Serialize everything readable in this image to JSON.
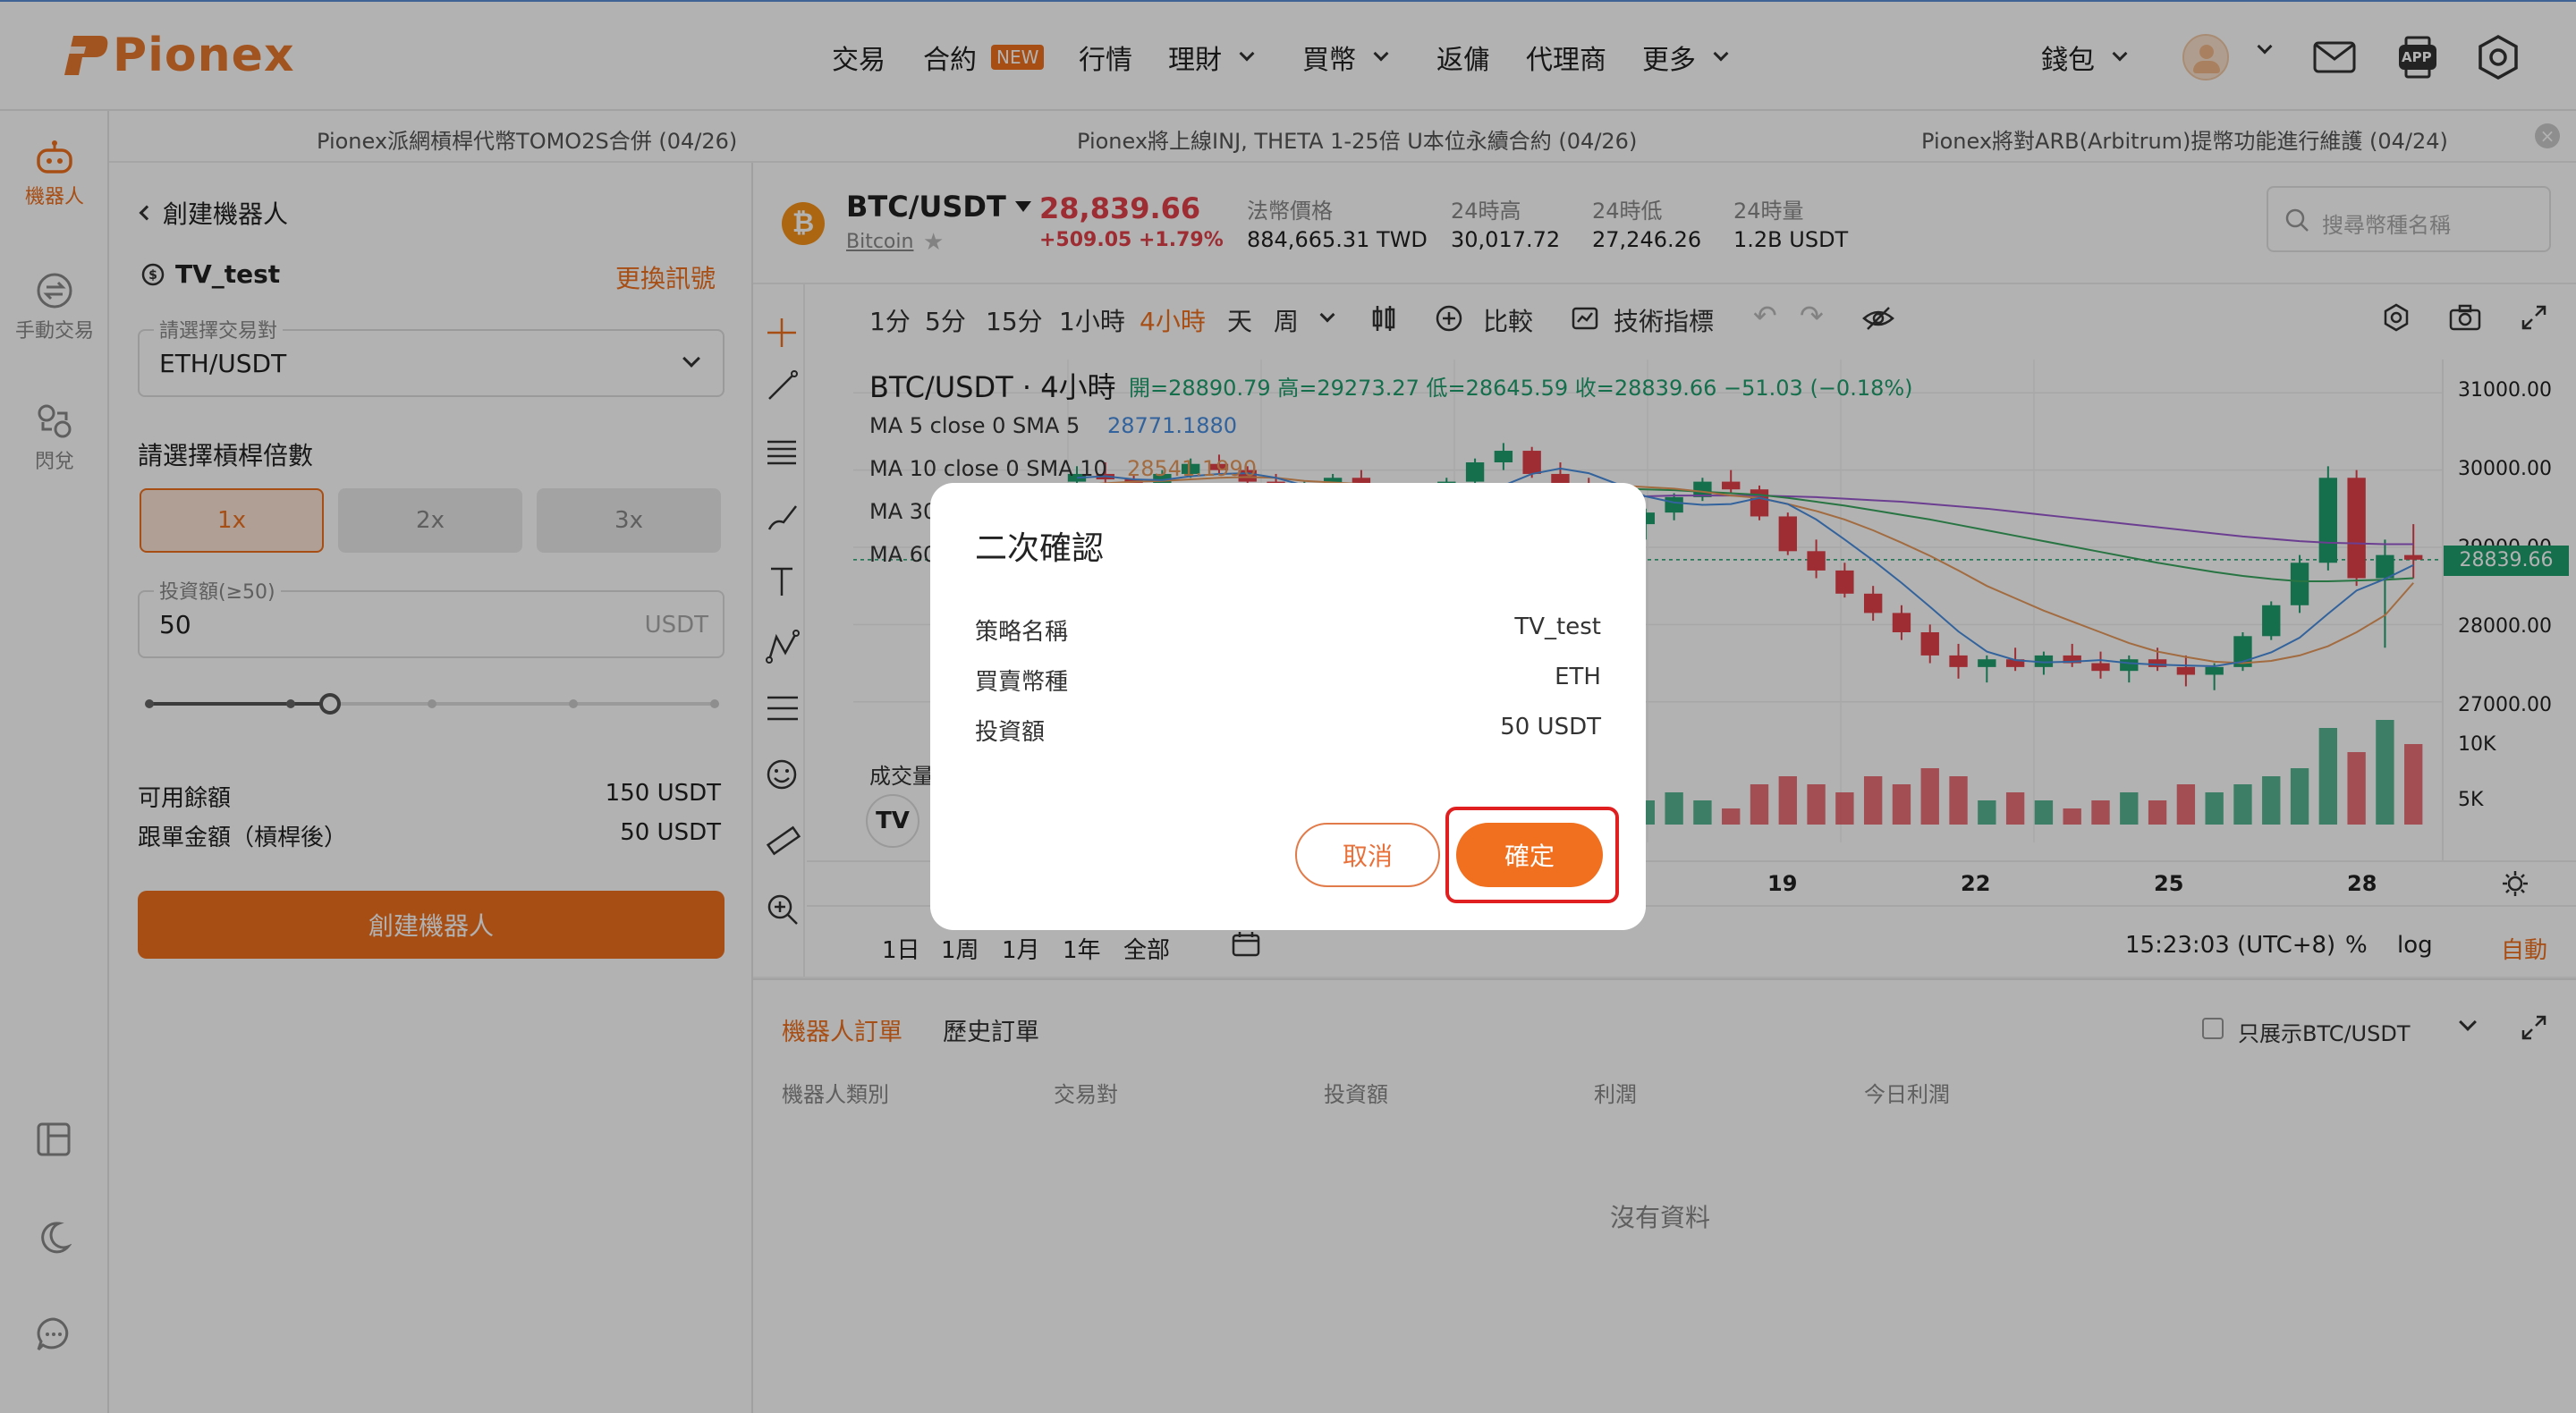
{
  "brand": {
    "name": "Pionex",
    "color": "#e9792f"
  },
  "nav": {
    "trade": "交易",
    "contract": "合約",
    "contract_badge": "NEW",
    "market": "行情",
    "finance": "理財",
    "buy": "買幣",
    "rebate": "返傭",
    "agent": "代理商",
    "more": "更多",
    "wallet": "錢包",
    "app_badge": "APP"
  },
  "sidebar": {
    "bot": "機器人",
    "manual": "手動交易",
    "flash": "閃兌"
  },
  "ticker": [
    "Pionex派網槓桿代幣TOMO2S合併 (04/26)",
    "Pionex將上線INJ, THETA 1-25倍 U本位永續合約 (04/26)",
    "Pionex將對ARB(Arbitrum)提幣功能進行維護 (04/24)"
  ],
  "left": {
    "back": "創建機器人",
    "strategy": "TV_test",
    "change_signal": "更換訊號",
    "pair_label": "請選擇交易對",
    "pair_value": "ETH/USDT",
    "leverage_title": "請選擇槓桿倍數",
    "lev": [
      "1x",
      "2x",
      "3x"
    ],
    "invest_label": "投資額(≥50)",
    "invest_value": "50",
    "invest_unit": "USDT",
    "slider_fraction": 0.32,
    "avail_label": "可用餘額",
    "avail_value": "150 USDT",
    "follow_label": "跟單金額（槓桿後）",
    "follow_value": "50 USDT",
    "create_btn": "創建機器人"
  },
  "market": {
    "pair": "BTC/USDT",
    "coin": "Bitcoin",
    "price": "28,839.66",
    "change": "+509.05 +1.79%",
    "fiat_label": "法幣價格",
    "fiat_value": "884,665.31 TWD",
    "high_label": "24時高",
    "high_value": "30,017.72",
    "low_label": "24時低",
    "low_value": "27,246.26",
    "vol_label": "24時量",
    "vol_value": "1.2B USDT",
    "search_placeholder": "搜尋幣種名稱"
  },
  "chart_toolbar": {
    "timeframes": [
      "1分",
      "5分",
      "15分",
      "1小時",
      "4小時",
      "天",
      "周"
    ],
    "active": "4小時",
    "compare": "比較",
    "indicators": "技術指標"
  },
  "chart_legend": {
    "title": "BTC/USDT · 4小時",
    "ohlc": "開=28890.79 高=29273.27 低=28645.59 收=28839.66 −51.03 (−0.18%)",
    "ma5_label": "MA 5 close 0 SMA 5",
    "ma5_value": "28771.1880",
    "ma10_label": "MA 10 close 0 SMA 10",
    "ma10_value": "28541.1990",
    "ma30": "MA 30",
    "ma60": "MA 60",
    "volume": "成交量"
  },
  "chart_data": {
    "type": "candlestick",
    "y_ticks": [
      "31000.00",
      "30000.00",
      "29000.00",
      "28000.00",
      "27000.00"
    ],
    "last_price": "28839.66",
    "x_ticks": [
      "19",
      "22",
      "25",
      "28"
    ],
    "vol_ticks": [
      "10K",
      "5K"
    ],
    "candles": [
      [
        29850,
        30050,
        29700,
        29950
      ],
      [
        29950,
        30100,
        29800,
        29880
      ],
      [
        29880,
        29950,
        29650,
        29750
      ],
      [
        29750,
        30000,
        29700,
        29950
      ],
      [
        29950,
        30150,
        29900,
        30080
      ],
      [
        30080,
        30200,
        29950,
        30000
      ],
      [
        30000,
        30050,
        29800,
        29850
      ],
      [
        29850,
        29950,
        29600,
        29700
      ],
      [
        29700,
        29850,
        29550,
        29800
      ],
      [
        29800,
        29950,
        29750,
        29900
      ],
      [
        29900,
        30000,
        29650,
        29700
      ],
      [
        29700,
        29800,
        29450,
        29500
      ],
      [
        29500,
        29700,
        29400,
        29650
      ],
      [
        29650,
        29900,
        29600,
        29850
      ],
      [
        29850,
        30150,
        29800,
        30100
      ],
      [
        30100,
        30350,
        30000,
        30250
      ],
      [
        30250,
        30300,
        29900,
        29950
      ],
      [
        29950,
        30100,
        29750,
        29800
      ],
      [
        29800,
        29900,
        29450,
        29500
      ],
      [
        29500,
        29600,
        29200,
        29300
      ],
      [
        29300,
        29500,
        29100,
        29450
      ],
      [
        29450,
        29700,
        29350,
        29650
      ],
      [
        29650,
        29900,
        29600,
        29850
      ],
      [
        29850,
        30000,
        29700,
        29750
      ],
      [
        29750,
        29800,
        29350,
        29400
      ],
      [
        29400,
        29450,
        28900,
        28950
      ],
      [
        28950,
        29100,
        28600,
        28700
      ],
      [
        28700,
        28800,
        28350,
        28400
      ],
      [
        28400,
        28500,
        28050,
        28150
      ],
      [
        28150,
        28250,
        27800,
        27900
      ],
      [
        27900,
        28000,
        27500,
        27600
      ],
      [
        27600,
        27750,
        27300,
        27450
      ],
      [
        27450,
        27600,
        27250,
        27550
      ],
      [
        27550,
        27700,
        27400,
        27450
      ],
      [
        27450,
        27650,
        27350,
        27600
      ],
      [
        27600,
        27750,
        27450,
        27500
      ],
      [
        27500,
        27650,
        27300,
        27400
      ],
      [
        27400,
        27600,
        27250,
        27550
      ],
      [
        27550,
        27700,
        27400,
        27450
      ],
      [
        27450,
        27600,
        27200,
        27350
      ],
      [
        27350,
        27500,
        27150,
        27450
      ],
      [
        27450,
        27900,
        27400,
        27850
      ],
      [
        27850,
        28300,
        27800,
        28250
      ],
      [
        28250,
        28900,
        28150,
        28800
      ],
      [
        28800,
        30050,
        28700,
        29900
      ],
      [
        29900,
        30000,
        28500,
        28600
      ],
      [
        28600,
        29100,
        27700,
        28900
      ],
      [
        28900,
        29300,
        28600,
        28840
      ]
    ],
    "volumes": [
      3,
      2,
      3,
      4,
      2,
      3,
      2,
      4,
      3,
      2,
      3,
      5,
      4,
      3,
      6,
      4,
      3,
      2,
      4,
      5,
      3,
      4,
      3,
      2,
      5,
      6,
      5,
      4,
      6,
      5,
      7,
      6,
      3,
      4,
      3,
      2,
      3,
      4,
      3,
      5,
      4,
      5,
      6,
      7,
      12,
      9,
      13,
      10
    ],
    "ma5": [
      29900,
      29920,
      29880,
      29870,
      29920,
      29950,
      29960,
      29900,
      29800,
      29780,
      29760,
      29720,
      29660,
      29640,
      29700,
      29800,
      29950,
      30020,
      29960,
      29820,
      29660,
      29580,
      29550,
      29560,
      29640,
      29560,
      29360,
      29100,
      28830,
      28540,
      28230,
      27910,
      27650,
      27540,
      27510,
      27520,
      27540,
      27500,
      27480,
      27470,
      27460,
      27520,
      27640,
      27830,
      28140,
      28440,
      28590,
      28770
    ],
    "ma10": [
      29800,
      29830,
      29850,
      29860,
      29880,
      29900,
      29910,
      29900,
      29860,
      29840,
      29820,
      29800,
      29760,
      29720,
      29700,
      29700,
      29740,
      29780,
      29800,
      29800,
      29780,
      29760,
      29720,
      29670,
      29640,
      29560,
      29470,
      29360,
      29220,
      29060,
      28890,
      28700,
      28500,
      28340,
      28180,
      28040,
      27900,
      27760,
      27650,
      27580,
      27520,
      27500,
      27530,
      27600,
      27720,
      27900,
      28120,
      28540
    ],
    "ma30": [
      29500,
      29540,
      29580,
      29610,
      29640,
      29670,
      29700,
      29720,
      29740,
      29760,
      29770,
      29780,
      29790,
      29790,
      29790,
      29790,
      29790,
      29780,
      29770,
      29760,
      29750,
      29740,
      29720,
      29700,
      29680,
      29640,
      29590,
      29540,
      29480,
      29420,
      29360,
      29290,
      29220,
      29150,
      29080,
      29010,
      28940,
      28870,
      28800,
      28740,
      28680,
      28630,
      28590,
      28560,
      28560,
      28570,
      28580,
      28600
    ],
    "ma60": [
      29300,
      29320,
      29340,
      29360,
      29380,
      29400,
      29420,
      29440,
      29460,
      29480,
      29500,
      29520,
      29540,
      29560,
      29580,
      29600,
      29620,
      29630,
      29640,
      29650,
      29660,
      29670,
      29670,
      29670,
      29670,
      29660,
      29650,
      29630,
      29610,
      29590,
      29560,
      29530,
      29500,
      29460,
      29420,
      29380,
      29340,
      29300,
      29260,
      29220,
      29180,
      29140,
      29110,
      29080,
      29060,
      29050,
      29040,
      29040
    ]
  },
  "chart_bottom": {
    "ranges": [
      "1日",
      "1周",
      "1月",
      "1年",
      "全部"
    ],
    "time": "15:23:03 (UTC+8)",
    "percent": "%",
    "log": "log",
    "auto": "自動"
  },
  "orders": {
    "tab_bot": "機器人訂單",
    "tab_history": "歷史訂單",
    "only_pair": "只展示BTC/USDT",
    "cols": [
      "機器人類別",
      "交易對",
      "投資額",
      "利潤",
      "今日利潤"
    ],
    "empty": "沒有資料"
  },
  "modal": {
    "title": "二次確認",
    "rows": [
      {
        "label": "策略名稱",
        "value": "TV_test"
      },
      {
        "label": "買賣幣種",
        "value": "ETH"
      },
      {
        "label": "投資額",
        "value": "50 USDT"
      }
    ],
    "cancel": "取消",
    "confirm": "確定"
  },
  "colors": {
    "accent": "#f0701f",
    "up": "#1f9e6e",
    "down": "#e2404a",
    "ma5": "#4a8ee0",
    "ma10": "#e89a5c",
    "ma30": "#3aa860",
    "ma60": "#9b59d0"
  }
}
